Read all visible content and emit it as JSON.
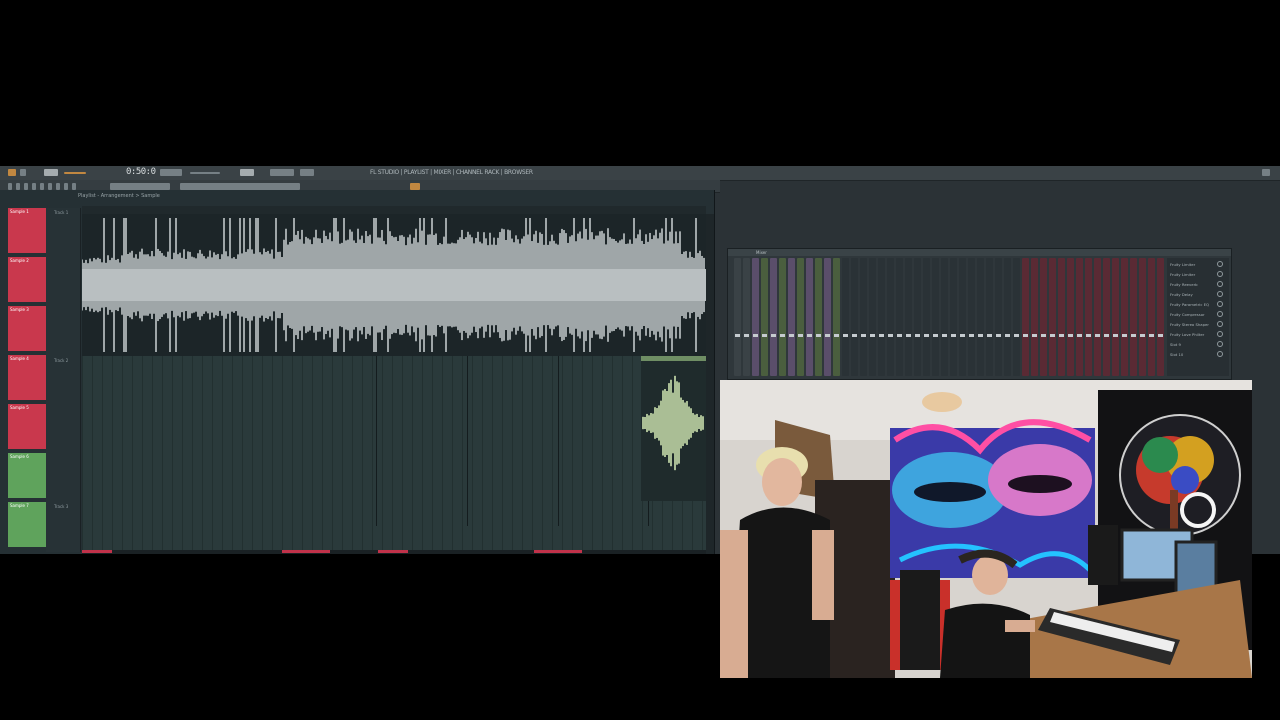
{
  "transport": {
    "time": "0:50:0",
    "menu_text": "FL STUDIO | PLAYLIST | MIXER | CHANNEL RACK | BROWSER"
  },
  "playlist": {
    "title": "Playlist - Arrangement > Sample",
    "ruler_label": "",
    "track_labels": [
      "Track 1",
      "Track 2",
      "Track 3"
    ]
  },
  "channels": [
    {
      "label": "Sample 1",
      "color": "#c9384d"
    },
    {
      "label": "Sample 2",
      "color": "#c9384d"
    },
    {
      "label": "Sample 3",
      "color": "#c9384d"
    },
    {
      "label": "Sample 4",
      "color": "#c9384d"
    },
    {
      "label": "Sample 5",
      "color": "#c9384d"
    },
    {
      "label": "Sample 6",
      "color": "#5fa35c"
    },
    {
      "label": "Sample 7",
      "color": "#5fa35c"
    }
  ],
  "mixer": {
    "title": "Mixer",
    "inserts": [
      "Fruity Limiter",
      "Fruity Limiter",
      "Fruity Reeverb",
      "Fruity Delay",
      "Fruity Parametric EQ",
      "Fruity Compressor",
      "Fruity Stereo Shaper",
      "Fruity Love Philter",
      "Slot 9",
      "Slot 10"
    ]
  },
  "colors": {
    "accent_red": "#c9384d",
    "accent_green": "#5fa35c",
    "background": "#2b3236"
  },
  "webcam": {
    "description": ""
  }
}
